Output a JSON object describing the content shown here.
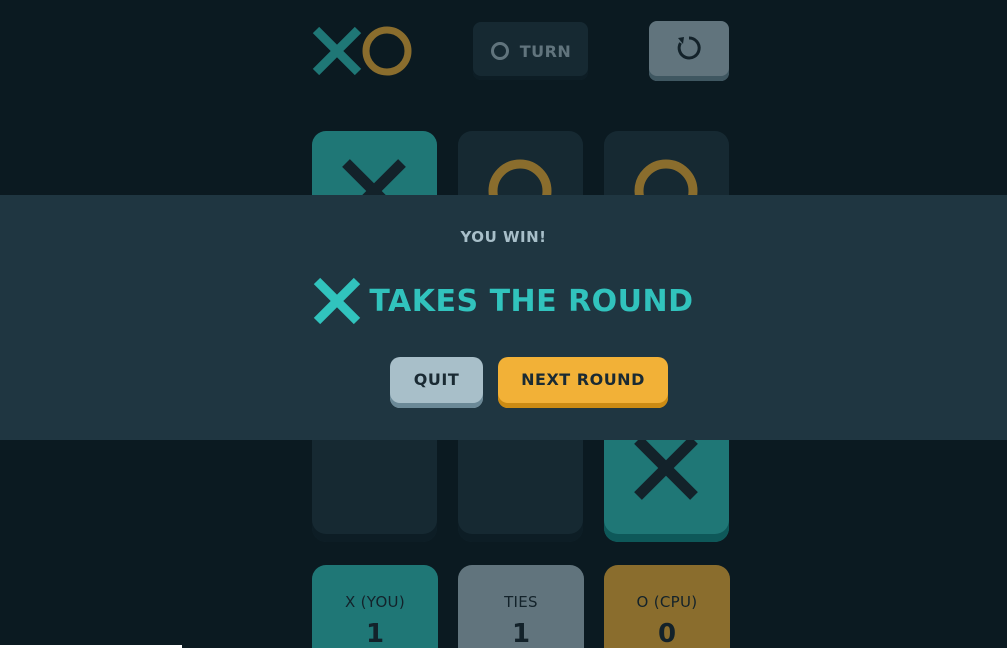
{
  "header": {
    "turn_label": "TURN",
    "turn_icon": "o-outline-icon",
    "restart_icon": "restart-arrow-icon"
  },
  "board": {
    "cells": [
      "x",
      "o",
      "o",
      "",
      "",
      "",
      "",
      "",
      "x"
    ],
    "winning_mark": "x"
  },
  "scores": {
    "x_label": "X (YOU)",
    "x_value": "1",
    "ties_label": "TIES",
    "ties_value": "1",
    "o_label": "O (CPU)",
    "o_value": "0"
  },
  "modal": {
    "subtitle": "YOU WIN!",
    "winner_icon": "x-icon",
    "title": "TAKES THE ROUND",
    "quit_label": "QUIT",
    "next_label": "NEXT ROUND"
  },
  "colors": {
    "background": "#0b1a21",
    "panel": "#1f3641",
    "x_color": "#31c3bd",
    "o_color": "#f2b137",
    "silver": "#a8bfc9",
    "dark_text": "#1a2a33"
  }
}
